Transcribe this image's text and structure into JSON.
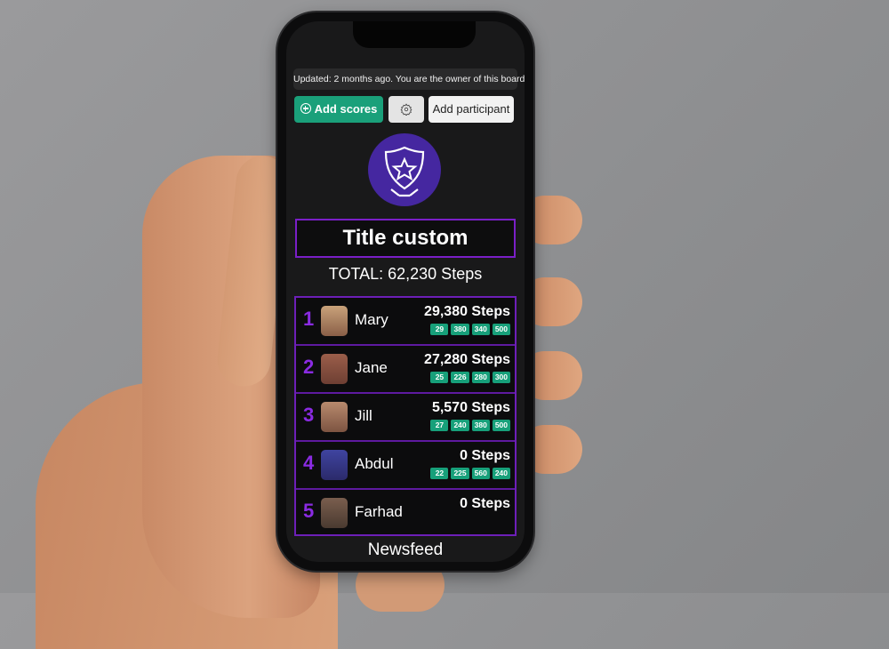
{
  "status": {
    "updated_text": "Updated: 2 months ago. You are the owner of this board."
  },
  "toolbar": {
    "add_scores_label": "Add scores",
    "add_scores_icon": "plus-circle-icon",
    "settings_icon": "gear-icon",
    "add_participant_label": "Add participant"
  },
  "board": {
    "badge_icon": "shield-star-icon",
    "title": "Title custom",
    "total": "TOTAL: 62,230 Steps",
    "participants": [
      {
        "rank": "1",
        "name": "Mary",
        "steps": "29,380 Steps",
        "chips": [
          "29",
          "380",
          "340",
          "500"
        ],
        "avatar_color": "#b08466"
      },
      {
        "rank": "2",
        "name": "Jane",
        "steps": "27,280 Steps",
        "chips": [
          "25",
          "226",
          "280",
          "300"
        ],
        "avatar_color": "#8e5a48"
      },
      {
        "rank": "3",
        "name": "Jill",
        "steps": "5,570 Steps",
        "chips": [
          "27",
          "240",
          "380",
          "500"
        ],
        "avatar_color": "#a77a62"
      },
      {
        "rank": "4",
        "name": "Abdul",
        "steps": "0 Steps",
        "chips": [
          "22",
          "225",
          "560",
          "240"
        ],
        "avatar_color": "#3a3c8a"
      },
      {
        "rank": "5",
        "name": "Farhad",
        "steps": "0 Steps",
        "chips": [],
        "avatar_color": "#6b5346"
      }
    ]
  },
  "footer": {
    "newsfeed_label": "Newsfeed"
  },
  "colors": {
    "accent_green": "#1aa07a",
    "accent_purple": "#7a1fc7",
    "badge_purple": "#4527a0"
  }
}
